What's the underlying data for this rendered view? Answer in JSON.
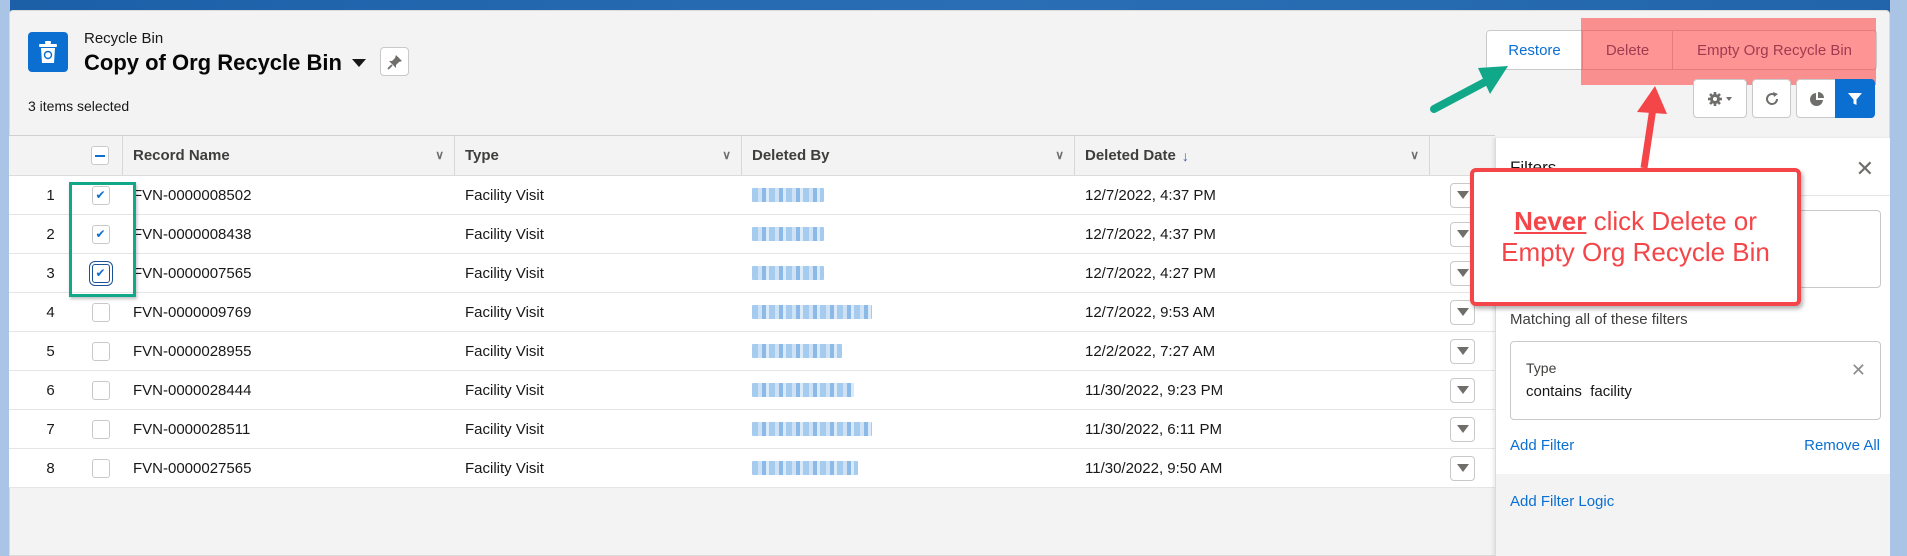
{
  "header": {
    "object_label": "Recycle Bin",
    "list_view_title": "Copy of Org Recycle Bin",
    "selection_status": "3 items selected",
    "icon": "recycle-bin-icon"
  },
  "actions": {
    "restore_label": "Restore",
    "delete_label": "Delete",
    "empty_label": "Empty Org Recycle Bin"
  },
  "toolbar_icons": [
    "gear-icon",
    "refresh-icon",
    "chart-icon",
    "filter-icon"
  ],
  "table": {
    "columns": [
      {
        "label": "Record Name",
        "sortable": true
      },
      {
        "label": "Type",
        "sortable": true
      },
      {
        "label": "Deleted By",
        "sortable": true
      },
      {
        "label": "Deleted Date",
        "sortable": true,
        "sorted": "descending"
      }
    ],
    "rows": [
      {
        "num": "1",
        "checked": true,
        "name": "FVN-0000008502",
        "type": "Facility Visit",
        "deleted_by": "[redacted]",
        "deleted_date": "12/7/2022, 4:37 PM"
      },
      {
        "num": "2",
        "checked": true,
        "name": "FVN-0000008438",
        "type": "Facility Visit",
        "deleted_by": "[redacted]",
        "deleted_date": "12/7/2022, 4:37 PM"
      },
      {
        "num": "3",
        "checked": true,
        "name": "FVN-0000007565",
        "type": "Facility Visit",
        "deleted_by": "[redacted]",
        "deleted_date": "12/7/2022, 4:27 PM"
      },
      {
        "num": "4",
        "checked": false,
        "name": "FVN-0000009769",
        "type": "Facility Visit",
        "deleted_by": "[redacted]",
        "deleted_date": "12/7/2022, 9:53 AM"
      },
      {
        "num": "5",
        "checked": false,
        "name": "FVN-0000028955",
        "type": "Facility Visit",
        "deleted_by": "[redacted]",
        "deleted_date": "12/2/2022, 7:27 AM"
      },
      {
        "num": "6",
        "checked": false,
        "name": "FVN-0000028444",
        "type": "Facility Visit",
        "deleted_by": "[redacted]",
        "deleted_date": "11/30/2022, 9:23 PM"
      },
      {
        "num": "7",
        "checked": false,
        "name": "FVN-0000028511",
        "type": "Facility Visit",
        "deleted_by": "[redacted]",
        "deleted_date": "11/30/2022, 6:11 PM"
      },
      {
        "num": "8",
        "checked": false,
        "name": "FVN-0000027565",
        "type": "Facility Visit",
        "deleted_by": "[redacted]",
        "deleted_date": "11/30/2022, 9:50 AM"
      }
    ]
  },
  "filters": {
    "title": "Filters",
    "matching_label": "Matching all of these filters",
    "items": [
      {
        "field": "Type",
        "operator": "contains",
        "value": "facility"
      }
    ],
    "add_filter_label": "Add Filter",
    "remove_all_label": "Remove All",
    "add_logic_label": "Add Filter Logic"
  },
  "annotation": {
    "emphasis": "Never",
    "line1_rest": " click Delete or",
    "line2": "Empty Org Recycle Bin",
    "warning_color": "#f44548",
    "highlight_color": "#11a88a"
  }
}
